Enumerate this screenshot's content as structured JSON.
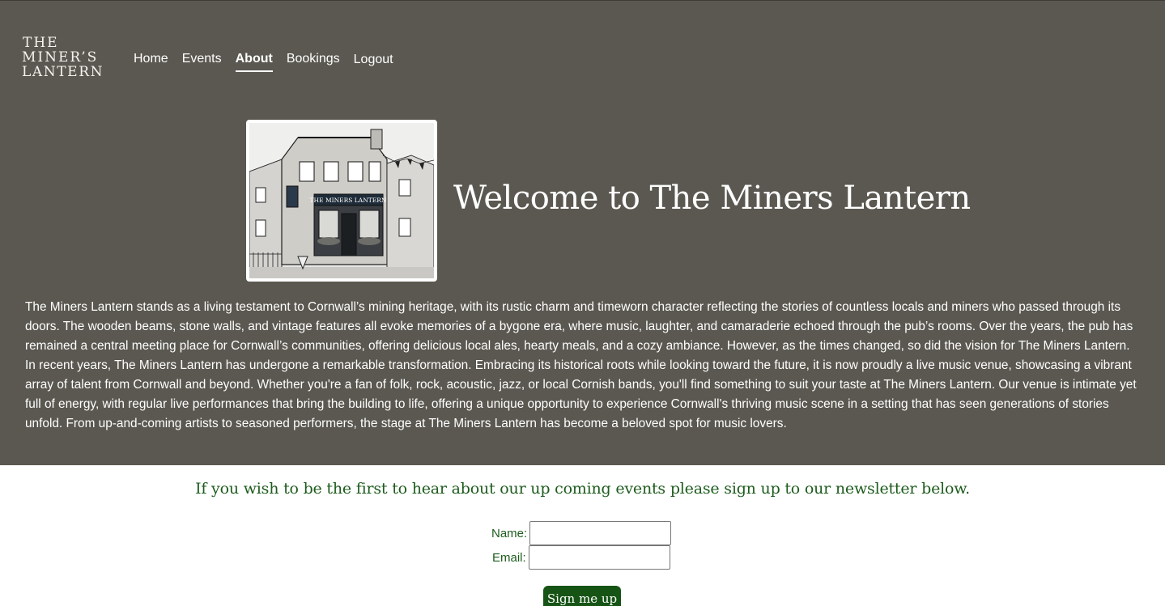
{
  "logo": {
    "line1": "THE",
    "line2": "MINER’S",
    "line3": "LANTERN"
  },
  "nav": {
    "items": [
      "Home",
      "Events",
      "About",
      "Bookings",
      "Logout"
    ],
    "active": "About"
  },
  "hero": {
    "image_sign_text": "THE MINERS LANTERN",
    "title": "Welcome to The Miners Lantern"
  },
  "about": {
    "paragraph1": "The Miners Lantern stands as a living testament to Cornwall’s mining heritage, with its rustic charm and timeworn character reflecting the stories of countless locals and miners who passed through its doors. The wooden beams, stone walls, and vintage features all evoke memories of a bygone era, where music, laughter, and camaraderie echoed through the pub’s rooms. Over the years, the pub has remained a central meeting place for Cornwall’s communities, offering delicious local ales, hearty meals, and a cozy ambiance. However, as the times changed, so did the vision for The Miners Lantern.",
    "paragraph2": "In recent years, The Miners Lantern has undergone a remarkable transformation. Embracing its historical roots while looking toward the future, it is now proudly a live music venue, showcasing a vibrant array of talent from Cornwall and beyond. Whether you're a fan of folk, rock, acoustic, jazz, or local Cornish bands, you'll find something to suit your taste at The Miners Lantern. Our venue is intimate yet full of energy, with regular live performances that bring the building to life, offering a unique opportunity to experience Cornwall's thriving music scene in a setting that has seen generations of stories unfold. From up-and-coming artists to seasoned performers, the stage at The Miners Lantern has become a beloved spot for music lovers."
  },
  "newsletter": {
    "title": "If you wish to be the first to hear about our up coming events please sign up to our newsletter below.",
    "name_label": "Name:",
    "name_value": "",
    "email_label": "Email:",
    "email_value": "",
    "submit_label": "Sign me up"
  },
  "colors": {
    "header_bg": "#5a5850",
    "accent_green": "#1d5c1d",
    "button_green": "#165416",
    "text_light": "#ffffff"
  }
}
